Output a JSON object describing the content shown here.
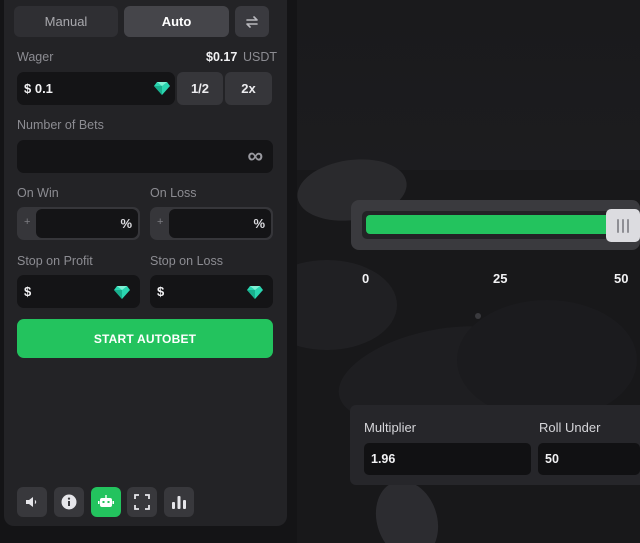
{
  "mode": {
    "manual_label": "Manual",
    "auto_label": "Auto",
    "active": "Auto"
  },
  "wager": {
    "label": "Wager",
    "amount_display": "$0.17",
    "currency": "USDT",
    "input_value": "$ 0.1",
    "half_label": "1/2",
    "double_label": "2x"
  },
  "bets": {
    "label": "Number of Bets",
    "value_symbol": "∞"
  },
  "on_win": {
    "label": "On Win",
    "prefix": "+",
    "suffix": "%"
  },
  "on_loss": {
    "label": "On Loss",
    "prefix": "+",
    "suffix": "%"
  },
  "stop_profit": {
    "label": "Stop on Profit",
    "prefix": "$"
  },
  "stop_loss": {
    "label": "Stop on Loss",
    "prefix": "$"
  },
  "start_button": {
    "label": "START AUTOBET"
  },
  "toolbar": {
    "items": [
      "sound-icon",
      "info-icon",
      "robot-icon",
      "fullscreen-icon",
      "stats-icon"
    ],
    "active": "robot-icon"
  },
  "game": {
    "slider": {
      "value": 50,
      "min": 0,
      "max": 50,
      "ticks": [
        "0",
        "25",
        "50"
      ]
    },
    "multiplier": {
      "label": "Multiplier",
      "value": "1.96"
    },
    "roll_under": {
      "label": "Roll Under",
      "value": "50"
    }
  },
  "colors": {
    "accent": "#23c35e",
    "panel": "#232326",
    "field": "#141416",
    "gem": "#2ad6b0"
  }
}
